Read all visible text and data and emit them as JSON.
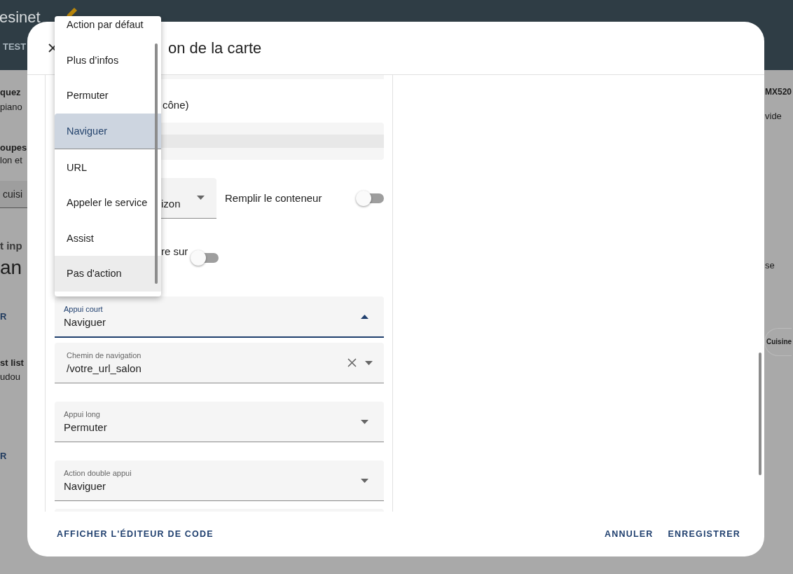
{
  "background": {
    "app_title": "esinet",
    "tab": "TEST",
    "left_items": [
      {
        "kind": "title",
        "text": "quez"
      },
      {
        "kind": "sub",
        "text": "piano"
      },
      {
        "kind": "title",
        "text": "oupes"
      },
      {
        "kind": "sub",
        "text": "lon et"
      },
      {
        "kind": "chip",
        "text": "cuisi"
      },
      {
        "kind": "heading",
        "text": "t inp"
      },
      {
        "kind": "big",
        "text": "an"
      },
      {
        "kind": "action",
        "text": "R"
      },
      {
        "kind": "title",
        "text": "st list"
      },
      {
        "kind": "sub",
        "text": "udou"
      },
      {
        "kind": "action",
        "text": "R"
      }
    ],
    "right_items": [
      {
        "kind": "title",
        "text": "MX520"
      },
      {
        "kind": "sub",
        "text": "vide"
      },
      {
        "kind": "sub",
        "text": "se"
      },
      {
        "kind": "chip",
        "text": "Cuisine"
      }
    ]
  },
  "dialog": {
    "title": "on de la carte",
    "editor": {
      "caption": "cône)",
      "align_select": {
        "value": "izon"
      },
      "fill_toggle": {
        "label": "Remplir le conteneur",
        "on": false
      },
      "hover_toggle": {
        "label": "re sur",
        "on": false
      },
      "fields": [
        {
          "kind": "select",
          "label": "Appui court",
          "value": "Naviguer",
          "expanded": true
        },
        {
          "kind": "combo",
          "label": "Chemin de navigation",
          "value": "/votre_url_salon",
          "expanded": false
        },
        {
          "kind": "select",
          "label": "Appui long",
          "value": "Permuter",
          "expanded": false
        },
        {
          "kind": "select",
          "label": "Action double appui",
          "value": "Naviguer",
          "expanded": false
        }
      ]
    },
    "footer": {
      "code_button": "AFFICHER L'ÉDITEUR DE CODE",
      "cancel": "ANNULER",
      "save": "ENREGISTRER"
    }
  },
  "menu": {
    "items": [
      {
        "label": "Action par défaut",
        "selected": false,
        "hovered": false
      },
      {
        "label": "Plus d’infos",
        "selected": false,
        "hovered": false
      },
      {
        "label": "Permuter",
        "selected": false,
        "hovered": false
      },
      {
        "label": "Naviguer",
        "selected": true,
        "hovered": false
      },
      {
        "label": "URL",
        "selected": false,
        "hovered": false
      },
      {
        "label": "Appeler le service",
        "selected": false,
        "hovered": false
      },
      {
        "label": "Assist",
        "selected": false,
        "hovered": false
      },
      {
        "label": "Pas d'action",
        "selected": false,
        "hovered": true
      }
    ]
  }
}
